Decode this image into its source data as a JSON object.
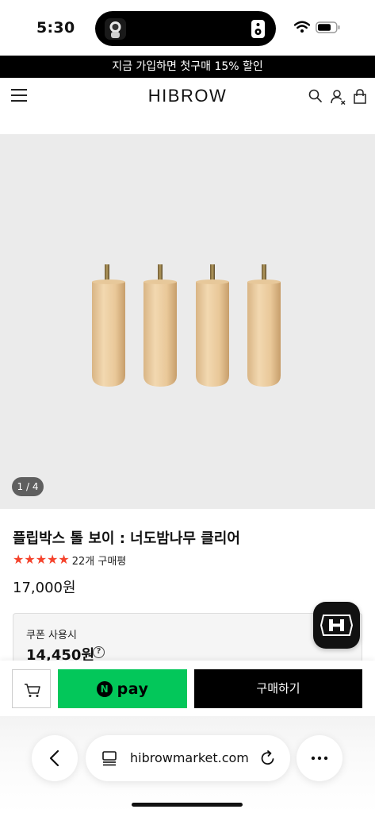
{
  "status_bar": {
    "time": "5:30",
    "icons": [
      "island-avatar-icon",
      "speaker-icon",
      "wifi-icon",
      "battery-icon"
    ]
  },
  "promo": {
    "text": "지금 가입하면 첫구매 15% 할인"
  },
  "header": {
    "brand": "HIBROW",
    "icons": [
      "menu-icon",
      "search-icon",
      "account-icon",
      "bag-icon"
    ]
  },
  "product": {
    "image_counter": "1 / 4",
    "title": "플립박스 톨 보이 : 너도밤나무 클리어",
    "rating_stars": 5,
    "review_count": "22개 구매평",
    "price": "17,000원",
    "coupon_label": "쿠폰 사용시",
    "coupon_price": "14,450원",
    "help_symbol": "?"
  },
  "purchase": {
    "cart_icon": "cart-icon",
    "npay_n": "N",
    "npay_label": "pay",
    "buy_label": "구매하기"
  },
  "browser": {
    "url": "hibrowmarket.com",
    "icons": [
      "back-icon",
      "tabs-icon",
      "reload-icon",
      "more-icon"
    ]
  },
  "colors": {
    "accent_star": "#f5432c",
    "npay_green": "#03c75a",
    "promo_bg": "#000000"
  }
}
